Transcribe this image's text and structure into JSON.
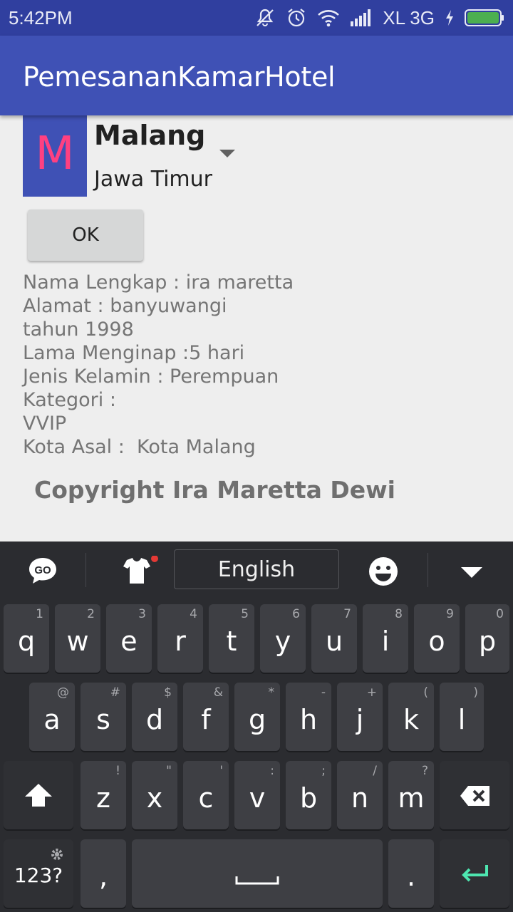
{
  "status_bar": {
    "time": "5:42PM",
    "carrier": "XL 3G",
    "icons": [
      "mute-icon",
      "alarm-icon",
      "wifi-icon",
      "signal-icon",
      "charging-icon",
      "battery-icon"
    ]
  },
  "app_bar": {
    "title": "PemesananKamarHotel"
  },
  "city_spinner": {
    "avatar_letter": "M",
    "city": "Malang",
    "province": "Jawa Timur"
  },
  "ok_button": {
    "label": "OK"
  },
  "result_lines": [
    "Nama Lengkap : ira maretta",
    "Alamat : banyuwangi",
    "tahun 1998",
    "Lama Menginap :5 hari",
    "Jenis Kelamin : Perempuan",
    "Kategori :",
    "VVIP",
    "Kota Asal :  Kota Malang"
  ],
  "copyright": "Copyright Ira Maretta Dewi",
  "keyboard": {
    "go_label": "GO",
    "language": "English",
    "row1": [
      {
        "key": "q",
        "hint": "1"
      },
      {
        "key": "w",
        "hint": "2"
      },
      {
        "key": "e",
        "hint": "3"
      },
      {
        "key": "r",
        "hint": "4"
      },
      {
        "key": "t",
        "hint": "5"
      },
      {
        "key": "y",
        "hint": "6"
      },
      {
        "key": "u",
        "hint": "7"
      },
      {
        "key": "i",
        "hint": "8"
      },
      {
        "key": "o",
        "hint": "9"
      },
      {
        "key": "p",
        "hint": "0"
      }
    ],
    "row2": [
      {
        "key": "a",
        "hint": "@"
      },
      {
        "key": "s",
        "hint": "#"
      },
      {
        "key": "d",
        "hint": "$"
      },
      {
        "key": "f",
        "hint": "&"
      },
      {
        "key": "g",
        "hint": "*"
      },
      {
        "key": "h",
        "hint": "-"
      },
      {
        "key": "j",
        "hint": "+"
      },
      {
        "key": "k",
        "hint": "("
      },
      {
        "key": "l",
        "hint": ")"
      }
    ],
    "row3": [
      {
        "key": "z",
        "hint": "!"
      },
      {
        "key": "x",
        "hint": "\""
      },
      {
        "key": "c",
        "hint": "'"
      },
      {
        "key": "v",
        "hint": ":"
      },
      {
        "key": "b",
        "hint": ";"
      },
      {
        "key": "n",
        "hint": "/"
      },
      {
        "key": "m",
        "hint": "?"
      }
    ],
    "symbols_label": "123?",
    "comma": ",",
    "period": ".",
    "accent_color": "#4ee6b0"
  }
}
